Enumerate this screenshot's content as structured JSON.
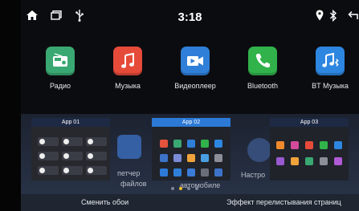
{
  "status_bar": {
    "time": "3:18",
    "icons": [
      "home-icon",
      "recent-apps-icon",
      "usb-icon",
      "location-pin-icon",
      "bluetooth-icon",
      "back-icon"
    ]
  },
  "apps": [
    {
      "label": "Радио",
      "icon": "radio-icon",
      "color": "#3aa872"
    },
    {
      "label": "Музыка",
      "icon": "music-note-icon",
      "color": "#e64b3a"
    },
    {
      "label": "Видеоплеер",
      "icon": "video-camera-icon",
      "color": "#2f7fd8"
    },
    {
      "label": "Bluetooth",
      "icon": "phone-icon",
      "color": "#31b24b"
    },
    {
      "label": "BT Музыка",
      "icon": "bluetooth-music-icon",
      "color": "#2d86e0"
    }
  ],
  "recents": {
    "behind_labels": {
      "file_manager_line1": "петчер",
      "file_manager_line2": "файлов",
      "car_line": "автомобиле",
      "settings": "Настро"
    },
    "cards": [
      {
        "title": "App 01",
        "title_color": "#1e2a44"
      },
      {
        "title": "App 02",
        "title_color": "#2c79d6"
      },
      {
        "title": "App 03",
        "title_color": "#1e2a44"
      }
    ]
  },
  "bottom_bar": {
    "wallpaper_label": "Сменить обои",
    "scroll_effect_label": "Эффект перелистывания страниц"
  }
}
